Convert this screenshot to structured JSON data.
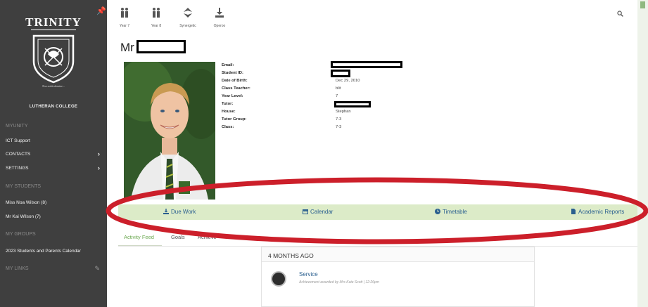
{
  "sidebar": {
    "crest_title": "TRINITY",
    "crest_motto": "Non nobis domine...",
    "college_name": "LUTHERAN COLLEGE",
    "sections": {
      "myunity": "MYUNITY",
      "my_students": "MY STUDENTS",
      "my_groups": "MY GROUPS",
      "my_links": "MY LINKS"
    },
    "items": {
      "ict_support": "ICT Support",
      "contacts": "CONTACTS",
      "settings": "SETTINGS",
      "student1": "Miss Noa Wilson (8)",
      "student2": "Mr Kai Wilson (7)",
      "calendar_group": "2023 Students and Parents Calendar"
    }
  },
  "topbar": {
    "items": [
      {
        "label": "Year 7",
        "icon": "people-icon"
      },
      {
        "label": "Year 8",
        "icon": "people-icon"
      },
      {
        "label": "Synergetic",
        "icon": "synergetic-icon"
      },
      {
        "label": "Operoo",
        "icon": "download-icon"
      }
    ],
    "search_icon": "search-icon"
  },
  "profile": {
    "title_prefix": "Mr",
    "labels": {
      "email": "Email:",
      "student_id": "Student ID:",
      "dob": "Date of Birth:",
      "class_teacher": "Class Teacher:",
      "year_level": "Year Level:",
      "tutor": "Tutor:",
      "house": "House:",
      "tutor_group": "Tutor Group:",
      "class": "Class:"
    },
    "values": {
      "dob": "Dec 29, 2010",
      "class_teacher": "blit",
      "year_level": "7",
      "house": "Stephan",
      "tutor_group": "7-3",
      "class": "7-3"
    }
  },
  "actions": [
    {
      "label": "Due Work",
      "icon": "download-icon"
    },
    {
      "label": "Calendar",
      "icon": "calendar-icon"
    },
    {
      "label": "Timetable",
      "icon": "clock-icon"
    },
    {
      "label": "Academic Reports",
      "icon": "document-icon"
    }
  ],
  "tabs": {
    "activity": "Activity Feed",
    "goals": "Goals",
    "achievements": "Achieve"
  },
  "feed": {
    "header": "4 MONTHS AGO",
    "item_title": "Service",
    "item_sub": "Achievement awarded by Mrs Kate Scott | 12:26pm"
  },
  "colors": {
    "sidebar_bg": "#3f3f3f",
    "action_bar_bg": "#dcebc8",
    "link_blue": "#2a5f8f",
    "active_tab_green": "#6aa84f",
    "annotation_red": "#cc1f2a"
  }
}
